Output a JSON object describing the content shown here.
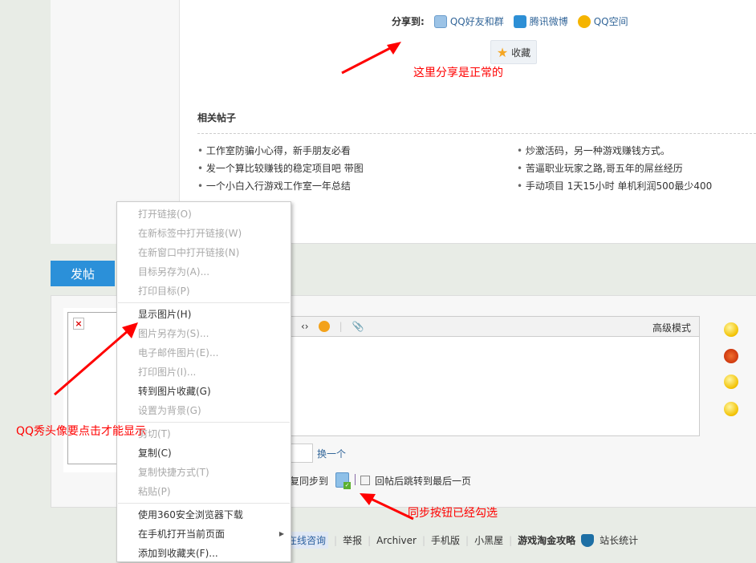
{
  "share": {
    "label": "分享到:",
    "items": [
      "QQ好友和群",
      "腾讯微博",
      "QQ空间"
    ],
    "favorite": "收藏"
  },
  "annotations": {
    "share_ok": "这里分享是正常的",
    "avatar_note": "QQ秀头像要点击才能显示",
    "sync_note": "同步按钮已经勾选"
  },
  "related": {
    "title": "相关帖子",
    "left": [
      "工作室防骗小心得，新手朋友必看",
      "发一个算比较赚钱的稳定项目吧 带图",
      "一个小白入行游戏工作室一年总结"
    ],
    "right": [
      "炒激活码，另一种游戏赚钱方式。",
      "苦逼职业玩家之路,哥五年的屌丝经历",
      "手动项目 1天15小时 单机利润500最少400"
    ]
  },
  "post": {
    "tab": "发帖",
    "advanced_mode": "高级模式",
    "change_captcha": "换一个",
    "sync_to": "复同步到",
    "jump_last": "回帖后跳转到最后一页",
    "broken_image": "×"
  },
  "context_menu": {
    "items": [
      {
        "label": "打开链接(O)",
        "disabled": true
      },
      {
        "label": "在新标签中打开链接(W)",
        "disabled": true
      },
      {
        "label": "在新窗口中打开链接(N)",
        "disabled": true
      },
      {
        "label": "目标另存为(A)...",
        "disabled": true
      },
      {
        "label": "打印目标(P)",
        "disabled": true
      },
      {
        "label": "显示图片(H)",
        "disabled": false
      },
      {
        "label": "图片另存为(S)...",
        "disabled": true
      },
      {
        "label": "电子邮件图片(E)...",
        "disabled": true
      },
      {
        "label": "打印图片(I)...",
        "disabled": true
      },
      {
        "label": "转到图片收藏(G)",
        "disabled": false
      },
      {
        "label": "设置为背景(G)",
        "disabled": true
      },
      {
        "label": "剪切(T)",
        "disabled": true
      },
      {
        "label": "复制(C)",
        "disabled": false
      },
      {
        "label": "复制快捷方式(T)",
        "disabled": true
      },
      {
        "label": "粘贴(P)",
        "disabled": true
      },
      {
        "label": "使用360安全浏览器下载",
        "disabled": false
      },
      {
        "label": "在手机打开当前页面",
        "disabled": false
      },
      {
        "label": "添加到收藏夹(F)...",
        "disabled": false
      }
    ]
  },
  "footer": {
    "consult": "在线咨询",
    "report": "举报",
    "archiver": "Archiver",
    "mobile": "手机版",
    "blackroom": "小黑屋",
    "brand": "游戏淘金攻略",
    "stats": "站长统计"
  }
}
